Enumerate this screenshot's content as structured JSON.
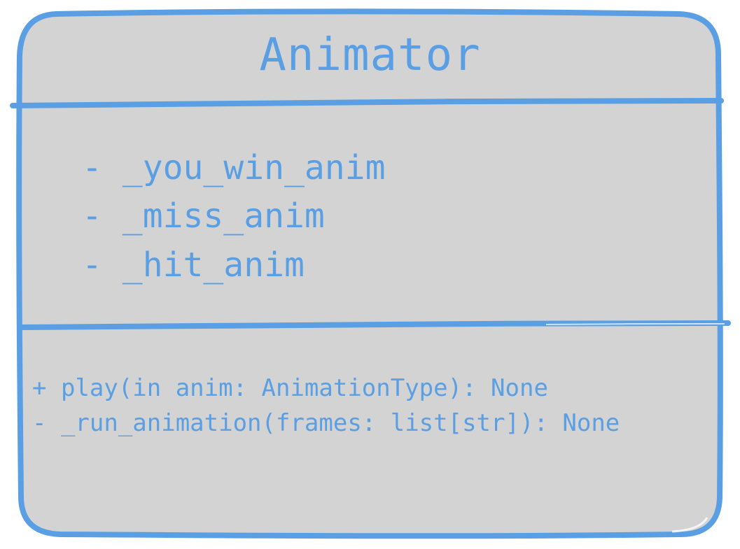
{
  "class_name": "Animator",
  "attributes": [
    "- _you_win_anim",
    "- _miss_anim",
    "- _hit_anim"
  ],
  "methods": [
    "+ play(in anim: AnimationType): None",
    "- _run_animation(frames: list[str]): None"
  ],
  "colors": {
    "stroke": "#5a9fe3",
    "fill": "#d3d3d3",
    "text": "#5a9fe3"
  }
}
